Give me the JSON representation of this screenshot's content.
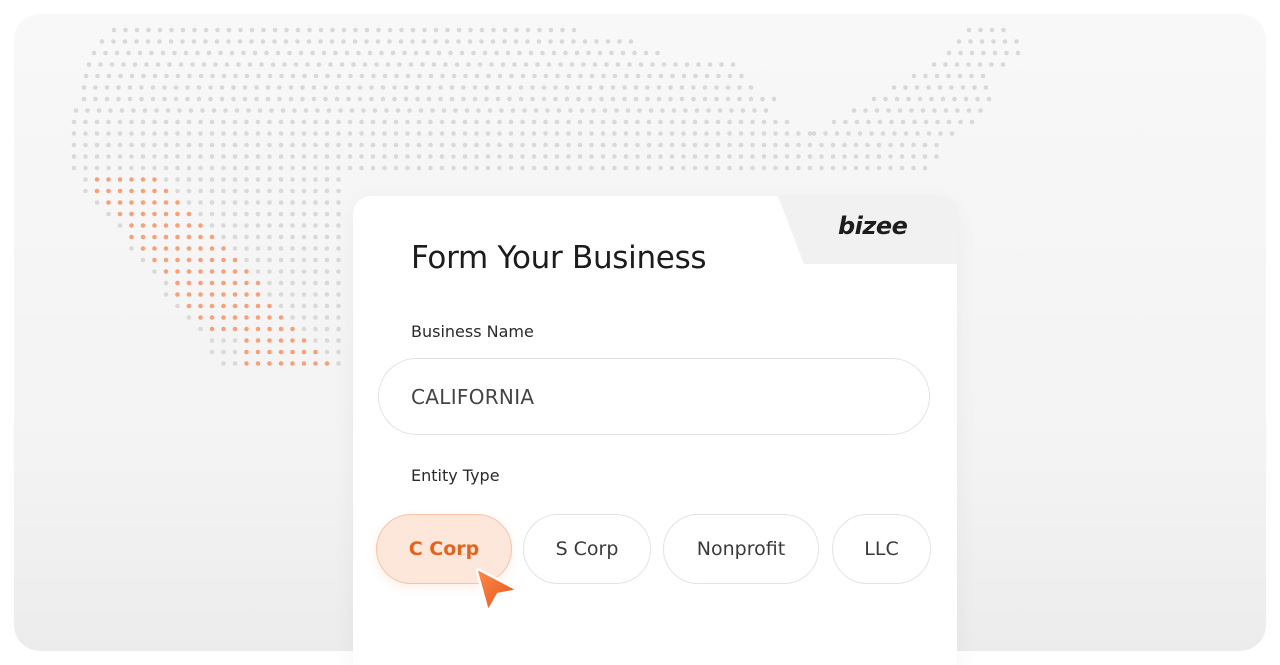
{
  "form": {
    "title": "Form Your Business",
    "business_name_label": "Business Name",
    "business_name_value": "CALIFORNIA",
    "entity_type_label": "Entity Type",
    "entity_options": [
      "C Corp",
      "S Corp",
      "Nonprofit",
      "LLC"
    ],
    "selected_entity": "C Corp"
  },
  "brand": {
    "logo_text": "bizee"
  },
  "colors": {
    "accent": "#ee6a25",
    "accent_light": "#fde6da",
    "map_dot": "#d9d9d9",
    "map_highlight": "#f5a27a"
  },
  "icons": {
    "cursor": "pointer-arrow-icon"
  }
}
